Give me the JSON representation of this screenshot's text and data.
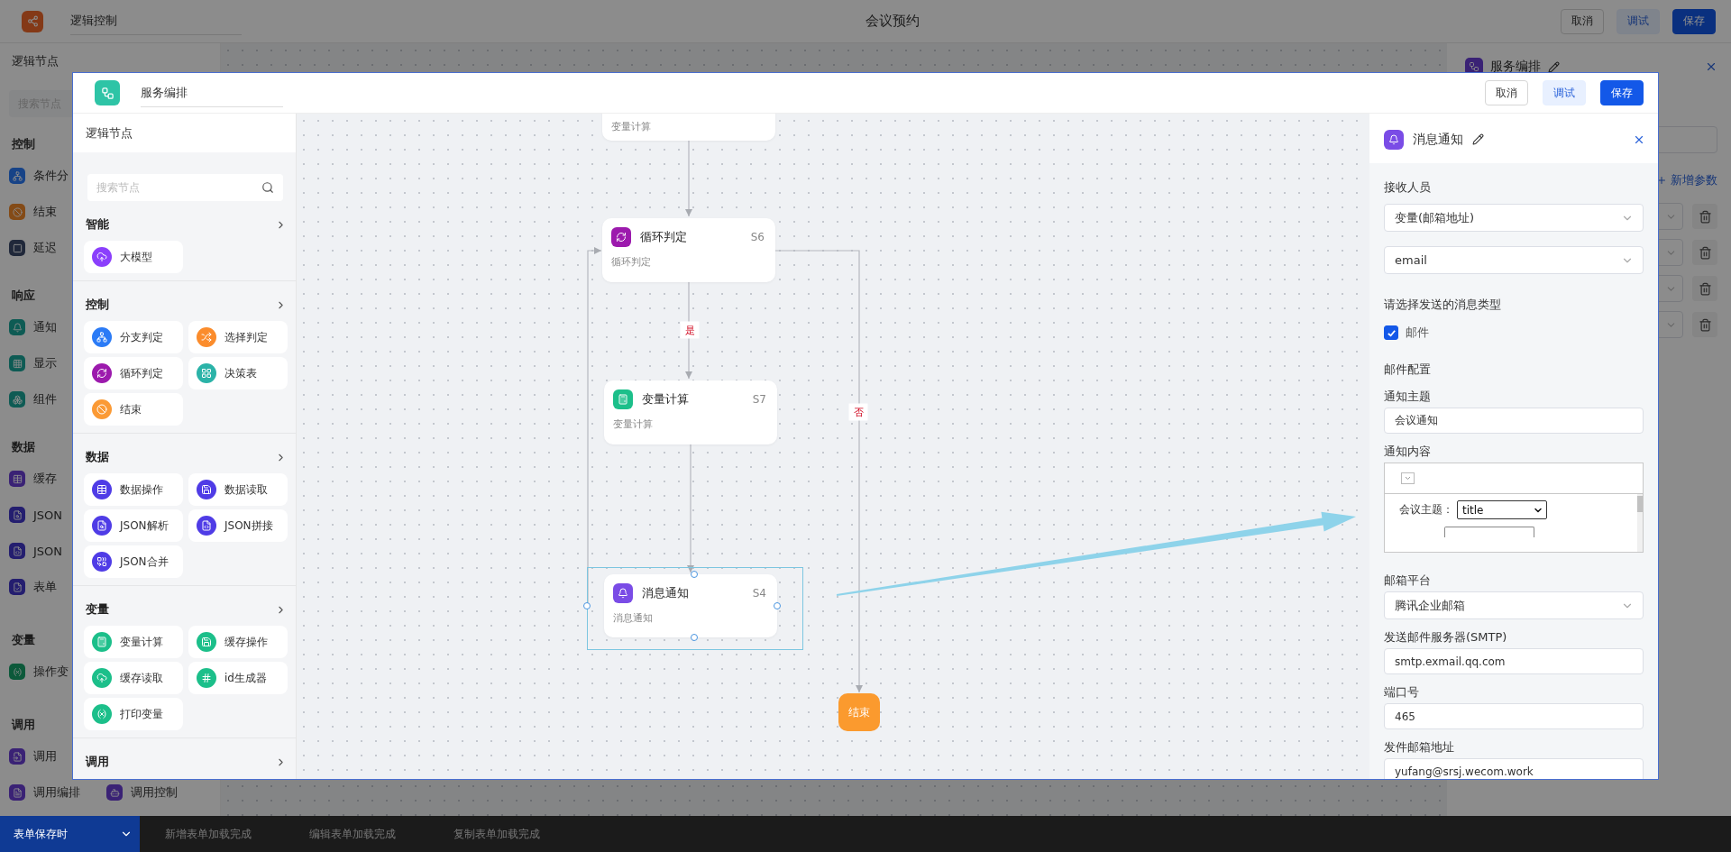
{
  "topbar": {
    "title_field": "逻辑控制",
    "page_title": "会议预约",
    "buttons": [
      {
        "label": "取消",
        "kind": "default"
      },
      {
        "label": "调试",
        "kind": "light"
      },
      {
        "label": "保存",
        "kind": "primary"
      }
    ]
  },
  "sidebar": {
    "title": "逻辑节点",
    "search": {
      "placeholder": "搜索节点"
    },
    "groups": [
      {
        "title": "控制",
        "rows": [
          [
            {
              "label": "条件分"
            }
          ],
          [
            {
              "label": "结束"
            }
          ],
          [
            {
              "label": "延迟"
            }
          ]
        ]
      },
      {
        "title": "响应",
        "rows": [
          [
            {
              "label": "通知"
            }
          ],
          [
            {
              "label": "显示"
            }
          ],
          [
            {
              "label": "组件"
            }
          ]
        ]
      },
      {
        "title": "数据",
        "rows": [
          [
            {
              "label": "缓存"
            }
          ],
          [
            {
              "label": "JSON"
            }
          ],
          [
            {
              "label": "JSON"
            }
          ],
          [
            {
              "label": "表单"
            }
          ]
        ]
      },
      {
        "title": "变量",
        "rows": [
          [
            {
              "label": "操作变"
            }
          ]
        ]
      },
      {
        "title": "调用",
        "rows": [
          [
            {
              "label": "调用"
            }
          ],
          [
            {
              "label": "调用编排"
            },
            {
              "label": "调用控制"
            }
          ]
        ]
      }
    ]
  },
  "service_panel": {
    "title": "服务编排",
    "add_param": "新增参数",
    "param_rows": [
      {
        "deletable": true
      },
      {
        "deletable": true
      },
      {
        "deletable": true
      },
      {
        "deletable": true
      }
    ]
  },
  "dialog": {
    "title_field": "服务编排",
    "buttons": [
      {
        "label": "取消",
        "kind": "default"
      },
      {
        "label": "调试",
        "kind": "light"
      },
      {
        "label": "保存",
        "kind": "primary"
      }
    ],
    "node_panel": {
      "title": "逻辑节点",
      "search": {
        "placeholder": "搜索节点"
      },
      "groups": [
        {
          "title": "智能",
          "items": [
            {
              "label": "大模型",
              "color": "#8b3ffc"
            }
          ]
        },
        {
          "title": "控制",
          "items": [
            {
              "label": "分支判定",
              "color": "#2b7bf6"
            },
            {
              "label": "选择判定",
              "color": "#fb8c2c"
            },
            {
              "label": "循环判定",
              "color": "#9c1aad"
            },
            {
              "label": "决策表",
              "color": "#2bb3a8"
            },
            {
              "label": "结束",
              "color": "#fb9a35"
            }
          ]
        },
        {
          "title": "数据",
          "items": [
            {
              "label": "数据操作",
              "color": "#4f3ce6"
            },
            {
              "label": "数据读取",
              "color": "#4f3ce6"
            },
            {
              "label": "JSON解析",
              "color": "#4f3ce6"
            },
            {
              "label": "JSON拼接",
              "color": "#4f3ce6"
            },
            {
              "label": "JSON合并",
              "color": "#4f3ce6"
            }
          ]
        },
        {
          "title": "变量",
          "items": [
            {
              "label": "变量计算",
              "color": "#1cbf8a"
            },
            {
              "label": "缓存操作",
              "color": "#1cbf8a"
            },
            {
              "label": "缓存读取",
              "color": "#1cbf8a"
            },
            {
              "label": "id生成器",
              "color": "#1cbf8a"
            },
            {
              "label": "打印变量",
              "color": "#1cbf8a"
            }
          ]
        },
        {
          "title": "调用"
        }
      ]
    },
    "canvas": {
      "nodes": [
        {
          "kind": "stub",
          "subtitle": "变量计算"
        },
        {
          "kind": "step",
          "title": "循环判定",
          "code": "S6",
          "subtitle": "循环判定",
          "color": "#9c1aad",
          "selected": false
        },
        {
          "kind": "step",
          "title": "变量计算",
          "code": "S7",
          "subtitle": "变量计算",
          "color": "#1cbf8a",
          "selected": false
        },
        {
          "kind": "step",
          "title": "消息通知",
          "code": "S4",
          "subtitle": "消息通知",
          "color": "#7a4ce6",
          "selected": true
        },
        {
          "kind": "end",
          "title": "结束"
        }
      ],
      "branch_labels": [
        "是",
        "否"
      ]
    },
    "config": {
      "title": "消息通知",
      "fields": [
        {
          "kind": "label",
          "text": "接收人员"
        },
        {
          "kind": "select",
          "value": "变量(邮箱地址)"
        },
        {
          "kind": "select",
          "value": "email"
        },
        {
          "kind": "label",
          "text": "请选择发送的消息类型"
        },
        {
          "kind": "checkbox",
          "label": "邮件",
          "checked": true
        },
        {
          "kind": "section",
          "text": "邮件配置"
        },
        {
          "kind": "label",
          "text": "通知主题"
        },
        {
          "kind": "input",
          "value": "会议通知"
        },
        {
          "kind": "label",
          "text": "通知内容"
        },
        {
          "kind": "editor",
          "field_label": "会议主题：",
          "field_value": "title"
        },
        {
          "kind": "label",
          "text": "邮箱平台"
        },
        {
          "kind": "select",
          "value": "腾讯企业邮箱"
        },
        {
          "kind": "label",
          "text": "发送邮件服务器(SMTP)"
        },
        {
          "kind": "input",
          "value": "smtp.exmail.qq.com"
        },
        {
          "kind": "label",
          "text": "端口号"
        },
        {
          "kind": "input",
          "value": "465"
        },
        {
          "kind": "label",
          "text": "发件邮箱地址"
        },
        {
          "kind": "input",
          "value": "yufang@srsj.wecom.work"
        }
      ]
    }
  },
  "bottom_bar": {
    "events": [
      {
        "label": "表单保存时",
        "selected": true,
        "dropdown": true
      },
      {
        "label": "新增表单加载完成",
        "selected": false
      },
      {
        "label": "编辑表单加载完成",
        "selected": false
      },
      {
        "label": "复制表单加载完成",
        "selected": false
      }
    ]
  }
}
